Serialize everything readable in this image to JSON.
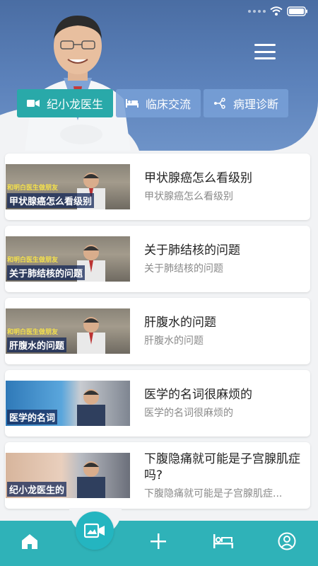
{
  "tabs": [
    {
      "label": "纪小龙医生",
      "icon": "video-camera-icon",
      "active": true
    },
    {
      "label": "临床交流",
      "icon": "bed-icon",
      "active": false
    },
    {
      "label": "病理诊断",
      "icon": "branch-icon",
      "active": false
    }
  ],
  "articles": [
    {
      "title": "甲状腺癌怎么看级别",
      "subtitle": "甲状腺癌怎么看级别",
      "thumb_caption": "甲状腺癌怎么看级别",
      "thumb_tag": "和明白医生做朋友"
    },
    {
      "title": "关于肺结核的问题",
      "subtitle": "关于肺结核的问题",
      "thumb_caption": "关于肺结核的问题",
      "thumb_tag": "和明白医生做朋友"
    },
    {
      "title": "肝腹水的问题",
      "subtitle": "肝腹水的问题",
      "thumb_caption": "肝腹水的问题",
      "thumb_tag": "和明白医生做朋友"
    },
    {
      "title": "医学的名词很麻烦的",
      "subtitle": "医学的名词很麻烦的",
      "thumb_caption": "医学的名词",
      "thumb_tag": ""
    },
    {
      "title": "下腹隐痛就可能是子宫腺肌症吗?",
      "subtitle": "下腹隐痛就可能是子宫腺肌症...",
      "thumb_caption": "纪小龙医生的",
      "thumb_tag": ""
    }
  ],
  "bottom_nav": [
    {
      "name": "home",
      "icon": "home-icon"
    },
    {
      "name": "video",
      "icon": "video-camera-icon"
    },
    {
      "name": "add",
      "icon": "plus-icon"
    },
    {
      "name": "clinic",
      "icon": "bed-icon"
    },
    {
      "name": "profile",
      "icon": "user-circle-icon"
    }
  ],
  "colors": {
    "header_blue": "#5c82bb",
    "accent_teal": "#29a9a9",
    "nav_teal": "#2fb2b8"
  }
}
